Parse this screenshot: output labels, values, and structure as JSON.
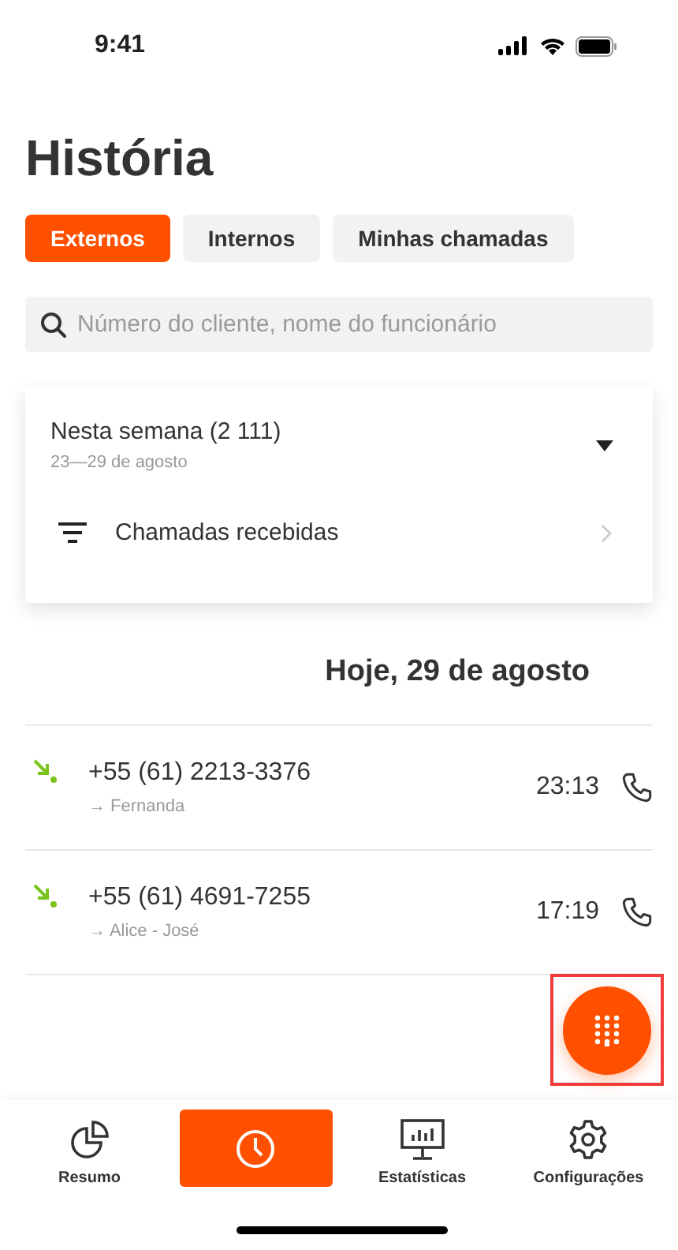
{
  "status_bar": {
    "time": "9:41"
  },
  "title": "História",
  "tabs": [
    {
      "label": "Externos",
      "selected": true
    },
    {
      "label": "Internos",
      "selected": false
    },
    {
      "label": "Minhas chamadas",
      "selected": false
    }
  ],
  "search": {
    "placeholder": "Número do cliente, nome do funcionário"
  },
  "filter_card": {
    "period": "Nesta semana (2 111)",
    "range": "23—29 de agosto",
    "filter": "Chamadas recebidas"
  },
  "day_heading": "Hoje, 29 de agosto",
  "calls": [
    {
      "kind": "incoming",
      "number": "+55 (61) 2213-3376",
      "target": "→ Fernanda",
      "time": "23:13"
    },
    {
      "kind": "incoming",
      "number": "+55 (61) 4691-7255",
      "target": "→ Alice - José",
      "time": "17:19"
    }
  ],
  "dialpad_button": {
    "highlighted": true
  },
  "bottom_nav": [
    {
      "kind": "summary",
      "label": "Resumo",
      "selected": false
    },
    {
      "kind": "history",
      "selected": true
    },
    {
      "kind": "stats",
      "label": "Estatísticas",
      "selected": false
    },
    {
      "kind": "settings",
      "label": "Configurações",
      "selected": false
    }
  ]
}
